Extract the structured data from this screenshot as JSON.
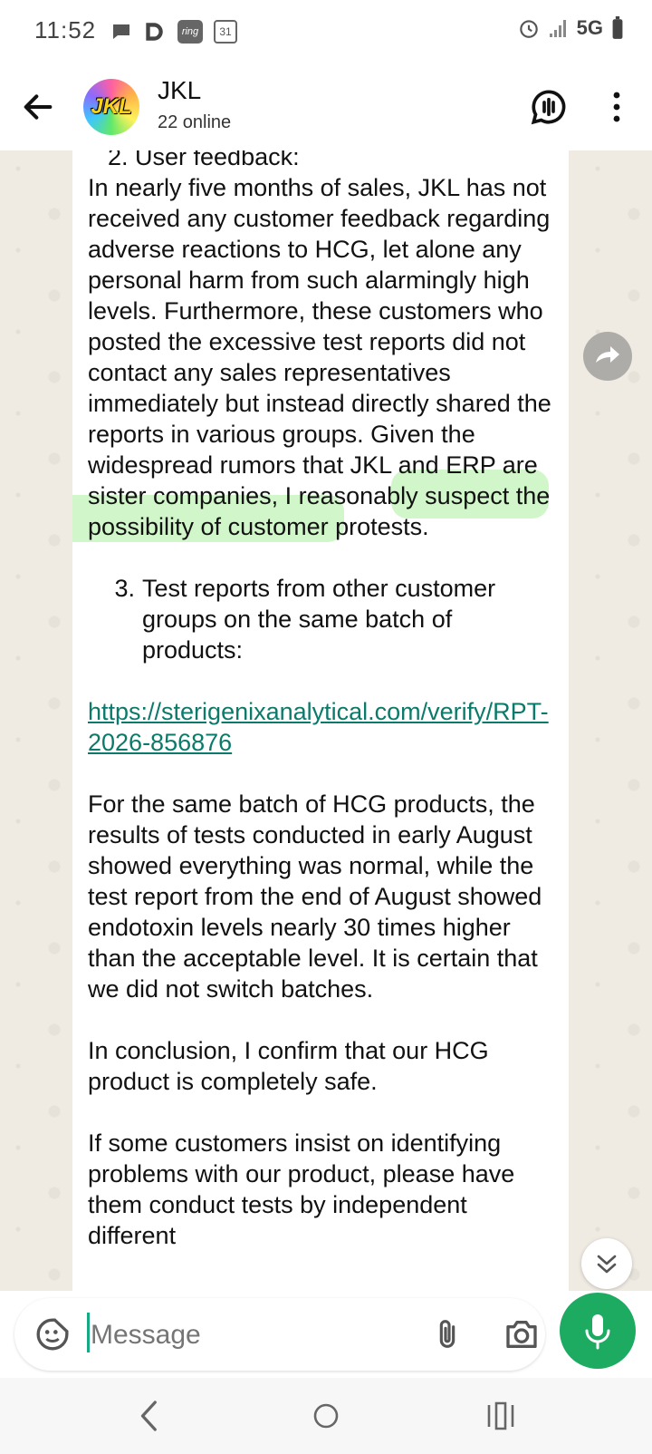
{
  "status": {
    "time": "11:52",
    "network": "5G",
    "notif_icons": [
      "chat-bubble-icon",
      "d-app-icon",
      "ring-icon",
      "calendar-31-icon"
    ],
    "ring_label": "ring",
    "calendar_label": "31"
  },
  "header": {
    "title": "JKL",
    "subtitle": "22 online",
    "avatar_text": "JKL"
  },
  "message": {
    "item2_heading": "2. User feedback:",
    "para1": "In nearly five months of sales, JKL has not received any customer feedback regarding adverse reactions to HCG, let alone any personal harm from such alarmingly high levels. Furthermore, these customers who posted the excessive test reports did not contact any sales representatives immediately but instead directly shared the reports in various groups. Given the widespread rumors that JKL and ERP are sister companies, I reasonably suspect the possibility of customer protests.",
    "item3_num": "3.",
    "item3_text": "Test reports from other customer groups on the same batch of products:",
    "link": "https://sterigenixanalytical.com/verify/RPT-2026-856876",
    "para2": "For the same batch of HCG products, the results of tests conducted in early August showed everything was normal, while the test report from the end of August showed endotoxin levels nearly 30 times higher than the acceptable level. It is certain that we did not switch batches.",
    "para3": "In conclusion, I confirm that our HCG product is completely safe.",
    "para4": "If some customers insist on identifying problems with our product, please have them conduct tests by independent different"
  },
  "composer": {
    "placeholder": "Message"
  },
  "colors": {
    "accent": "#1daa61",
    "link": "#0b7a6a",
    "chat_bg": "#efeae2"
  }
}
